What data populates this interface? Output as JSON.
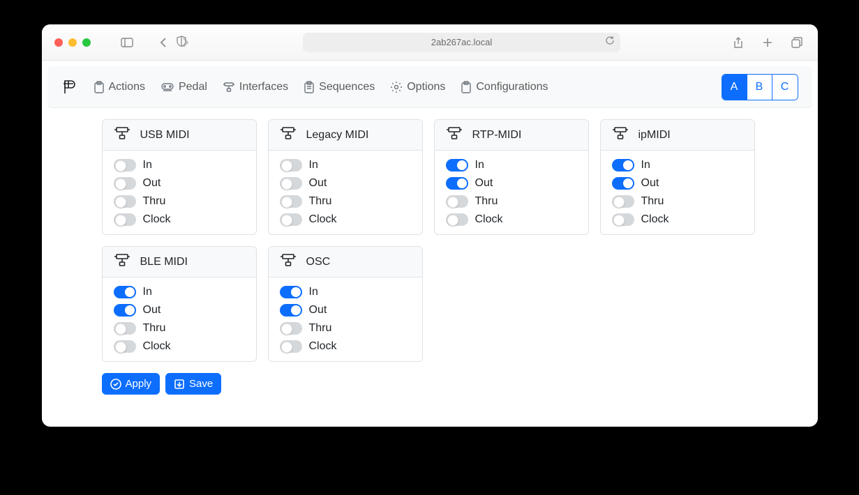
{
  "browser": {
    "url": "2ab267ac.local"
  },
  "nav": {
    "items": [
      {
        "id": "actions",
        "label": "Actions"
      },
      {
        "id": "pedal",
        "label": "Pedal"
      },
      {
        "id": "interfaces",
        "label": "Interfaces"
      },
      {
        "id": "sequences",
        "label": "Sequences"
      },
      {
        "id": "options",
        "label": "Options"
      },
      {
        "id": "configurations",
        "label": "Configurations"
      }
    ],
    "profiles": [
      {
        "label": "A",
        "active": true
      },
      {
        "label": "B",
        "active": false
      },
      {
        "label": "C",
        "active": false
      }
    ]
  },
  "interfaces": [
    {
      "title": "USB MIDI",
      "toggles": {
        "in": false,
        "out": false,
        "thru": false,
        "clock": false
      }
    },
    {
      "title": "Legacy MIDI",
      "toggles": {
        "in": false,
        "out": false,
        "thru": false,
        "clock": false
      }
    },
    {
      "title": "RTP-MIDI",
      "toggles": {
        "in": true,
        "out": true,
        "thru": false,
        "clock": false
      }
    },
    {
      "title": "ipMIDI",
      "toggles": {
        "in": true,
        "out": true,
        "thru": false,
        "clock": false
      }
    },
    {
      "title": "BLE MIDI",
      "toggles": {
        "in": true,
        "out": true,
        "thru": false,
        "clock": false
      }
    },
    {
      "title": "OSC",
      "toggles": {
        "in": true,
        "out": true,
        "thru": false,
        "clock": false
      }
    }
  ],
  "toggle_labels": {
    "in": "In",
    "out": "Out",
    "thru": "Thru",
    "clock": "Clock"
  },
  "buttons": {
    "apply": "Apply",
    "save": "Save"
  }
}
